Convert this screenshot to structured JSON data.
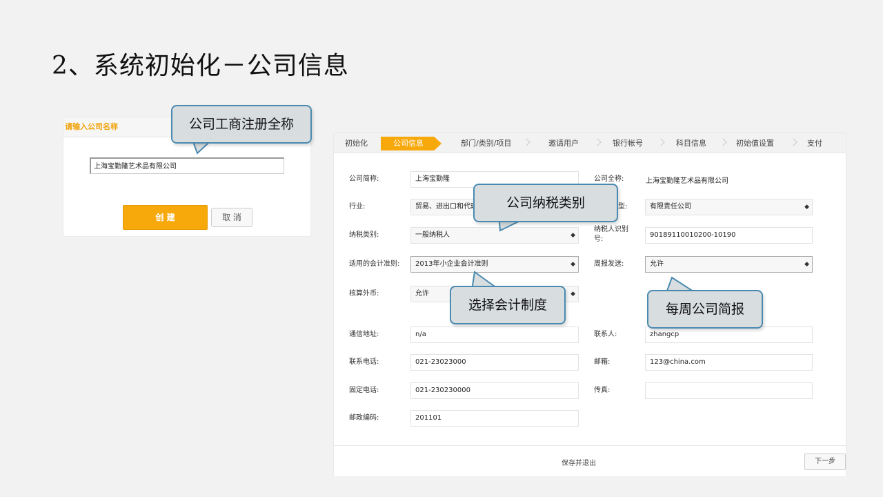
{
  "slide": {
    "title": "2、系统初始化－公司信息"
  },
  "dialog": {
    "header": "请输入公司名称",
    "company_value": "上海宝勤隆艺术品有限公司",
    "create_label": "创 建",
    "cancel_label": "取 消"
  },
  "steps": [
    {
      "label": "初始化"
    },
    {
      "label": "公司信息",
      "active": true
    },
    {
      "label": "部门/类别/项目"
    },
    {
      "label": "邀请用户"
    },
    {
      "label": "银行帐号"
    },
    {
      "label": "科目信息"
    },
    {
      "label": "初始值设置"
    },
    {
      "label": "支付"
    }
  ],
  "form": {
    "short_name": {
      "label": "公司简称:",
      "value": "上海宝勤隆"
    },
    "full_name": {
      "label": "公司全称:",
      "value": "上海宝勤隆艺术品有限公司"
    },
    "industry": {
      "label": "行业:",
      "value": "贸易、进出口和代理"
    },
    "company_type": {
      "label": "型:",
      "value": "有限责任公司"
    },
    "tax_category": {
      "label": "纳税类别:",
      "value": "一般纳税人"
    },
    "taxpayer_id": {
      "label": "纳税人识别号:",
      "value": "90189110010200-10190"
    },
    "accounting_standard": {
      "label": "适用的会计准则:",
      "value": "2013年小企业会计准则"
    },
    "weekly_report": {
      "label": "周报发送:",
      "value": "允许"
    },
    "foreign_currency": {
      "label": "核算外币:",
      "value": "允许"
    },
    "address": {
      "label": "通信地址:",
      "value": "n/a"
    },
    "contact": {
      "label": "联系人:",
      "value": "zhangcp"
    },
    "phone": {
      "label": "联系电话:",
      "value": "021-23023000"
    },
    "email": {
      "label": "邮箱:",
      "value": "123@china.com"
    },
    "landline": {
      "label": "固定电话:",
      "value": "021-230230000"
    },
    "fax": {
      "label": "传真:",
      "value": ""
    },
    "postcode": {
      "label": "邮政编码:",
      "value": "201101"
    }
  },
  "footer": {
    "save_exit": "保存并退出",
    "next": "下一步"
  },
  "callouts": {
    "company_name": "公司工商注册全称",
    "tax_type": "公司纳税类别",
    "accounting": "选择会计制度",
    "weekly": "每周公司简报"
  }
}
